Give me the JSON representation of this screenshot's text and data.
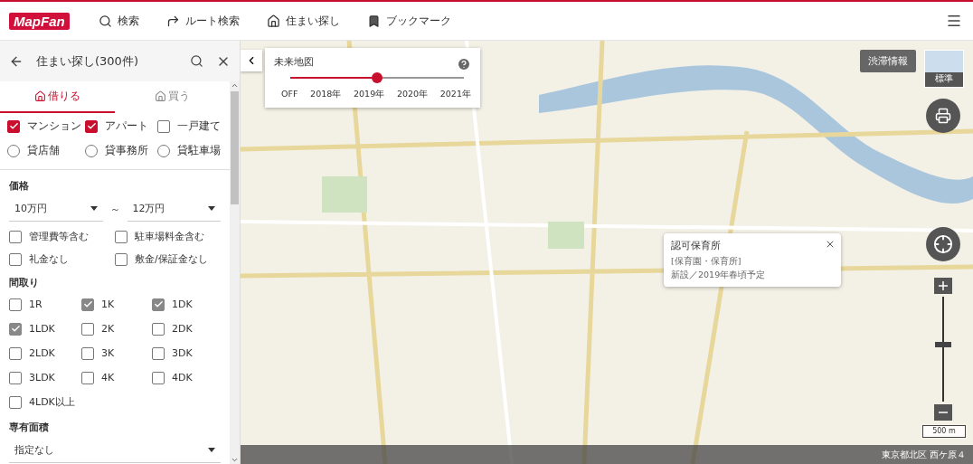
{
  "header": {
    "logo": "MapFan",
    "nav": [
      {
        "kind": "search",
        "label": "検索"
      },
      {
        "kind": "route",
        "label": "ルート検索"
      },
      {
        "kind": "house",
        "label": "住まい探し"
      },
      {
        "kind": "bookmark",
        "label": "ブックマーク"
      }
    ]
  },
  "panel": {
    "title": "住まい探し(300件)",
    "tabs": [
      {
        "label": "借りる",
        "selected": true
      },
      {
        "label": "買う",
        "selected": false
      }
    ],
    "property_types": [
      {
        "kind": "checkbox",
        "label": "マンション",
        "checked": true
      },
      {
        "kind": "checkbox",
        "label": "アパート",
        "checked": true
      },
      {
        "kind": "checkbox",
        "label": "一戸建て",
        "checked": false
      },
      {
        "kind": "radio",
        "label": "貸店舗",
        "checked": false
      },
      {
        "kind": "radio",
        "label": "貸事務所",
        "checked": false
      },
      {
        "kind": "radio",
        "label": "貸駐車場",
        "checked": false
      }
    ],
    "price": {
      "heading": "価格",
      "min": "10万円",
      "separator": "～",
      "max": "12万円",
      "options": [
        {
          "label": "管理費等含む",
          "checked": false
        },
        {
          "label": "駐車場料金含む",
          "checked": false
        },
        {
          "label": "礼金なし",
          "checked": false
        },
        {
          "label": "敷金/保証金なし",
          "checked": false
        }
      ]
    },
    "floor_plan": {
      "heading": "間取り",
      "options": [
        {
          "label": "1R",
          "checked": false
        },
        {
          "label": "1K",
          "checked": true
        },
        {
          "label": "1DK",
          "checked": true
        },
        {
          "label": "1LDK",
          "checked": true
        },
        {
          "label": "2K",
          "checked": false
        },
        {
          "label": "2DK",
          "checked": false
        },
        {
          "label": "2LDK",
          "checked": false
        },
        {
          "label": "3K",
          "checked": false
        },
        {
          "label": "3DK",
          "checked": false
        },
        {
          "label": "3LDK",
          "checked": false
        },
        {
          "label": "4K",
          "checked": false
        },
        {
          "label": "4DK",
          "checked": false
        },
        {
          "label": "4LDK以上",
          "checked": false
        }
      ]
    },
    "area": {
      "heading": "専有面積",
      "value": "指定なし"
    }
  },
  "map": {
    "future_map": {
      "title": "未来地図",
      "level": 0.5,
      "ticks": [
        "OFF",
        "2018年",
        "2019年",
        "2020年",
        "2021年"
      ]
    },
    "traffic_button": "渋滞情報",
    "map_type": "標準",
    "popup": {
      "title": "認可保育所",
      "category": "[保育園・保育所]",
      "note": "新設／2019年春頃予定"
    },
    "zoom": {
      "level": 0.54
    },
    "scale": "500 m",
    "address": "東京都北区 西ケ原４"
  }
}
